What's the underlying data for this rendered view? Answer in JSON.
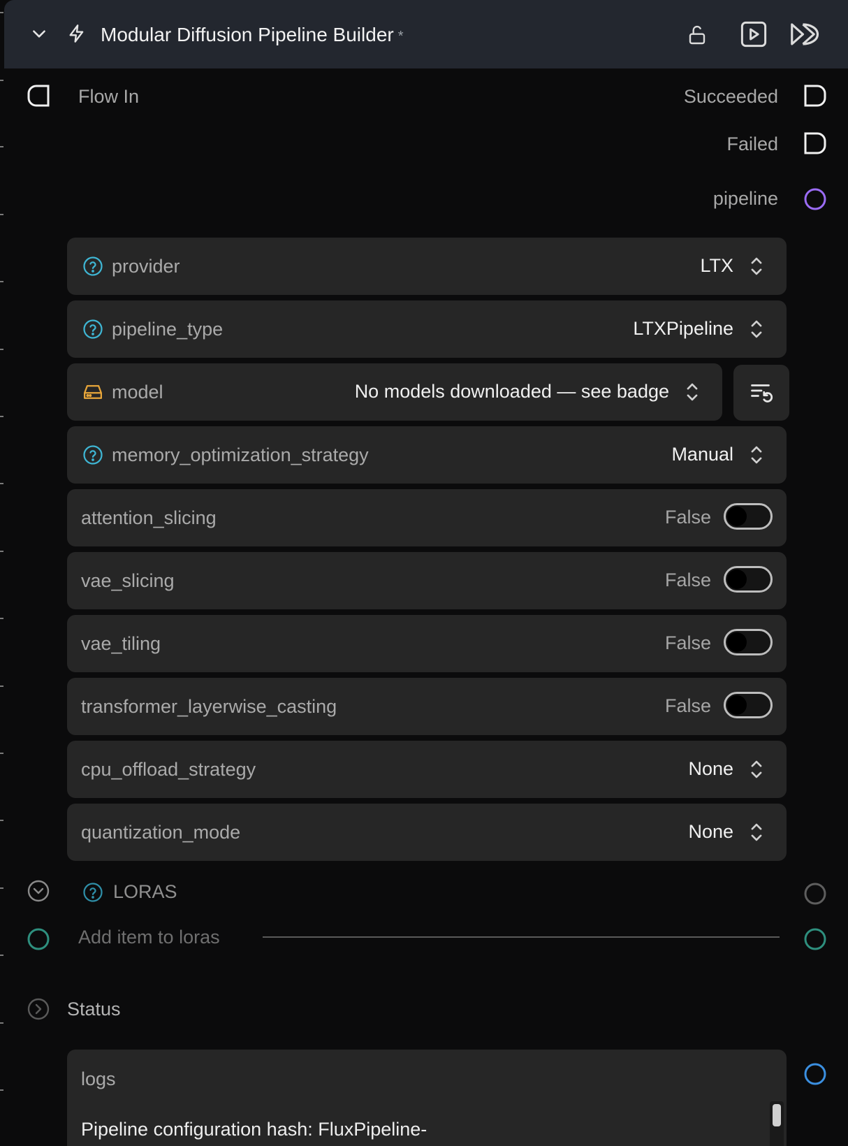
{
  "header": {
    "title": "Modular Diffusion Pipeline Builder",
    "modified_marker": "*"
  },
  "ports": {
    "flow_in": "Flow In",
    "succeeded": "Succeeded",
    "failed": "Failed",
    "pipeline": "pipeline"
  },
  "params": [
    {
      "label": "provider",
      "value": "LTX"
    },
    {
      "label": "pipeline_type",
      "value": "LTXPipeline"
    },
    {
      "label": "model",
      "value": "No models downloaded — see badge"
    },
    {
      "label": "memory_optimization_strategy",
      "value": "Manual"
    },
    {
      "label": "attention_slicing",
      "value": "False"
    },
    {
      "label": "vae_slicing",
      "value": "False"
    },
    {
      "label": "vae_tiling",
      "value": "False"
    },
    {
      "label": "transformer_layerwise_casting",
      "value": "False"
    },
    {
      "label": "cpu_offload_strategy",
      "value": "None"
    },
    {
      "label": "quantization_mode",
      "value": "None"
    }
  ],
  "loras": {
    "title": "LORAS",
    "add_item": "Add item to loras"
  },
  "status": {
    "title": "Status",
    "logs_label": "logs",
    "logs_text": "Pipeline configuration hash: FluxPipeline-"
  },
  "colors": {
    "header_bg": "#23272f",
    "help_icon": "#3fb6d4",
    "model_icon": "#e8a63a",
    "pipeline_port": "#9b6cf5",
    "teal_port": "#2e8f7e",
    "logs_port": "#3b8fe0"
  }
}
